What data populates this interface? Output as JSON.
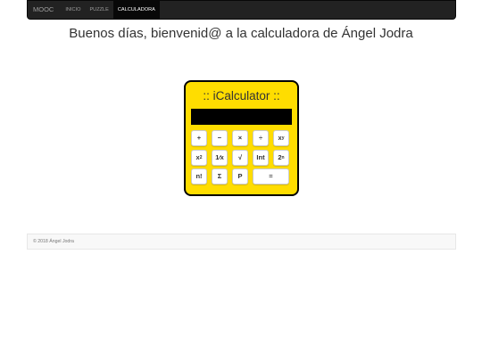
{
  "navbar": {
    "brand": "MOOC",
    "items": [
      {
        "label": "INICIO",
        "active": false
      },
      {
        "label": "PUZZLE",
        "active": false
      },
      {
        "label": "CALCULADORA",
        "active": true
      }
    ]
  },
  "main": {
    "welcome": "Buenos días, bienvenid@ a la calculadora de Ángel Jodra"
  },
  "calculator": {
    "title": ":: iCalculator ::",
    "display_value": "",
    "keys": {
      "add": "+",
      "subtract": "−",
      "multiply": "×",
      "divide": "÷",
      "power_base": "x",
      "power_exp": "y",
      "square_base": "x",
      "square_exp": "2",
      "reciprocal": "1⁄x",
      "sqrt": "√",
      "int": "Int",
      "pow2_base": "2",
      "pow2_exp": "n",
      "factorial": "n!",
      "sum": "Σ",
      "product": "P",
      "equals": "="
    }
  },
  "footer": {
    "copyright": "© 2018 Ángel Jodra"
  },
  "colors": {
    "navbar_bg": "#222222",
    "calculator_bg": "#ffdd00",
    "display_bg": "#000000"
  }
}
